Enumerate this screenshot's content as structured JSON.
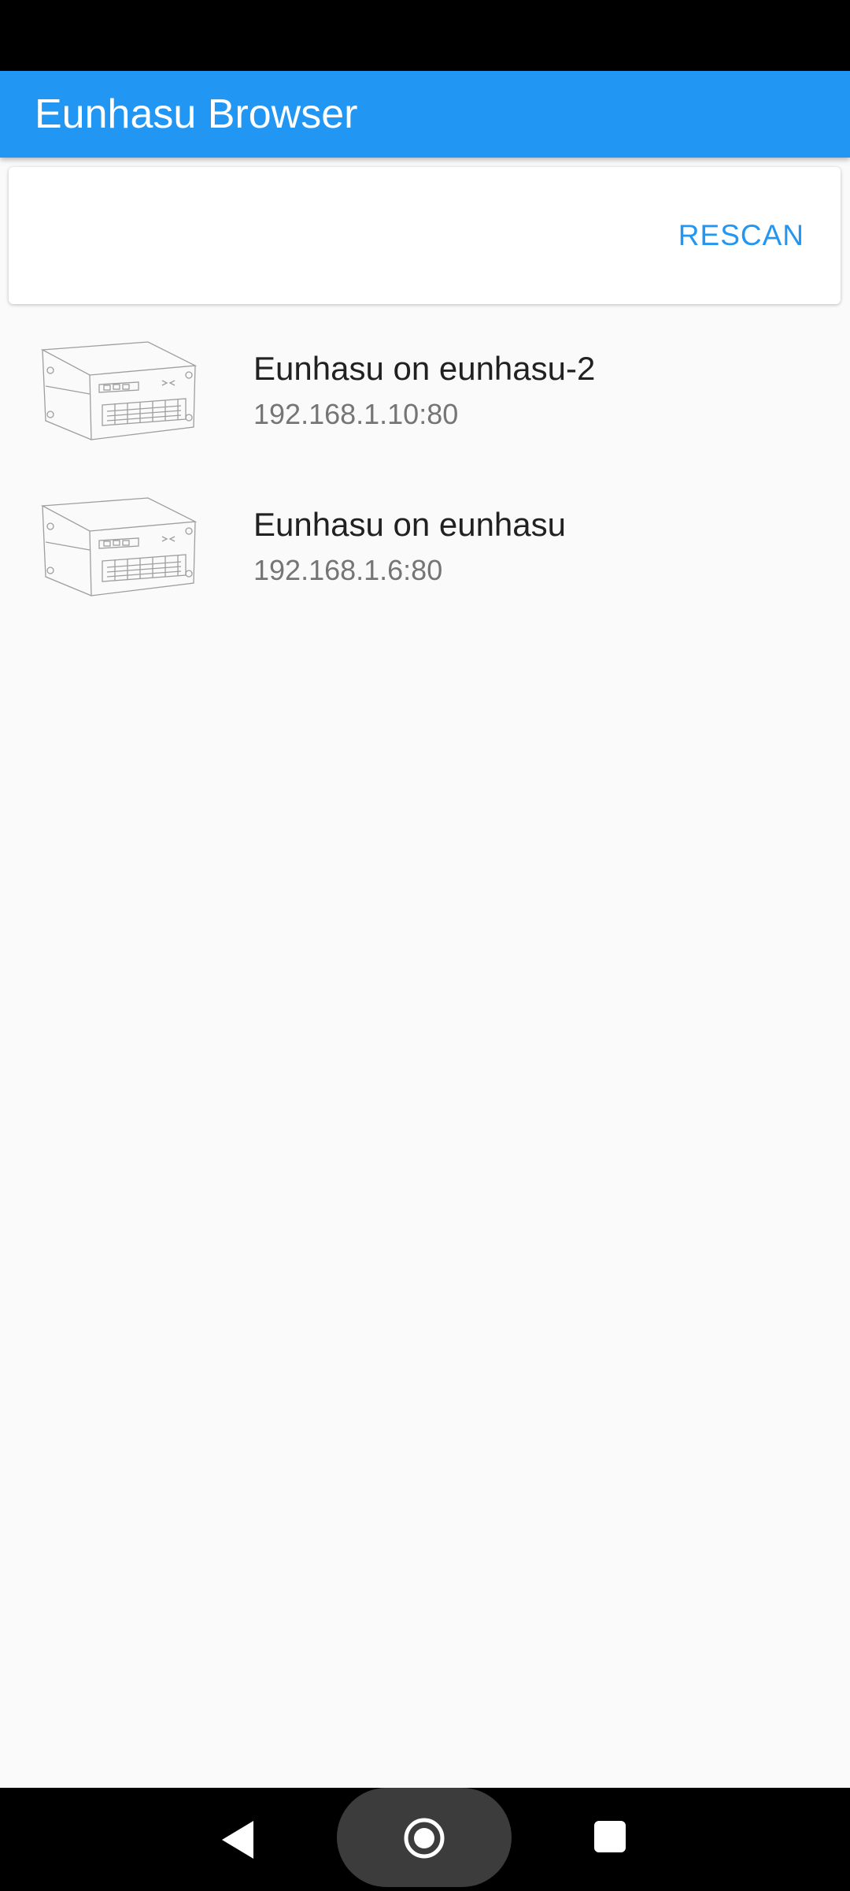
{
  "app": {
    "title": "Eunhasu Browser",
    "accent_color": "#2196f3"
  },
  "scan": {
    "rescan_label": "RESCAN"
  },
  "devices": [
    {
      "name": "Eunhasu on eunhasu-2",
      "address": "192.168.1.10:80",
      "icon": "server-box-icon"
    },
    {
      "name": "Eunhasu on eunhasu",
      "address": "192.168.1.6:80",
      "icon": "server-box-icon"
    }
  ],
  "navigation": {
    "back_icon": "back-triangle-icon",
    "home_icon": "home-circle-icon",
    "recents_icon": "recents-square-icon"
  }
}
